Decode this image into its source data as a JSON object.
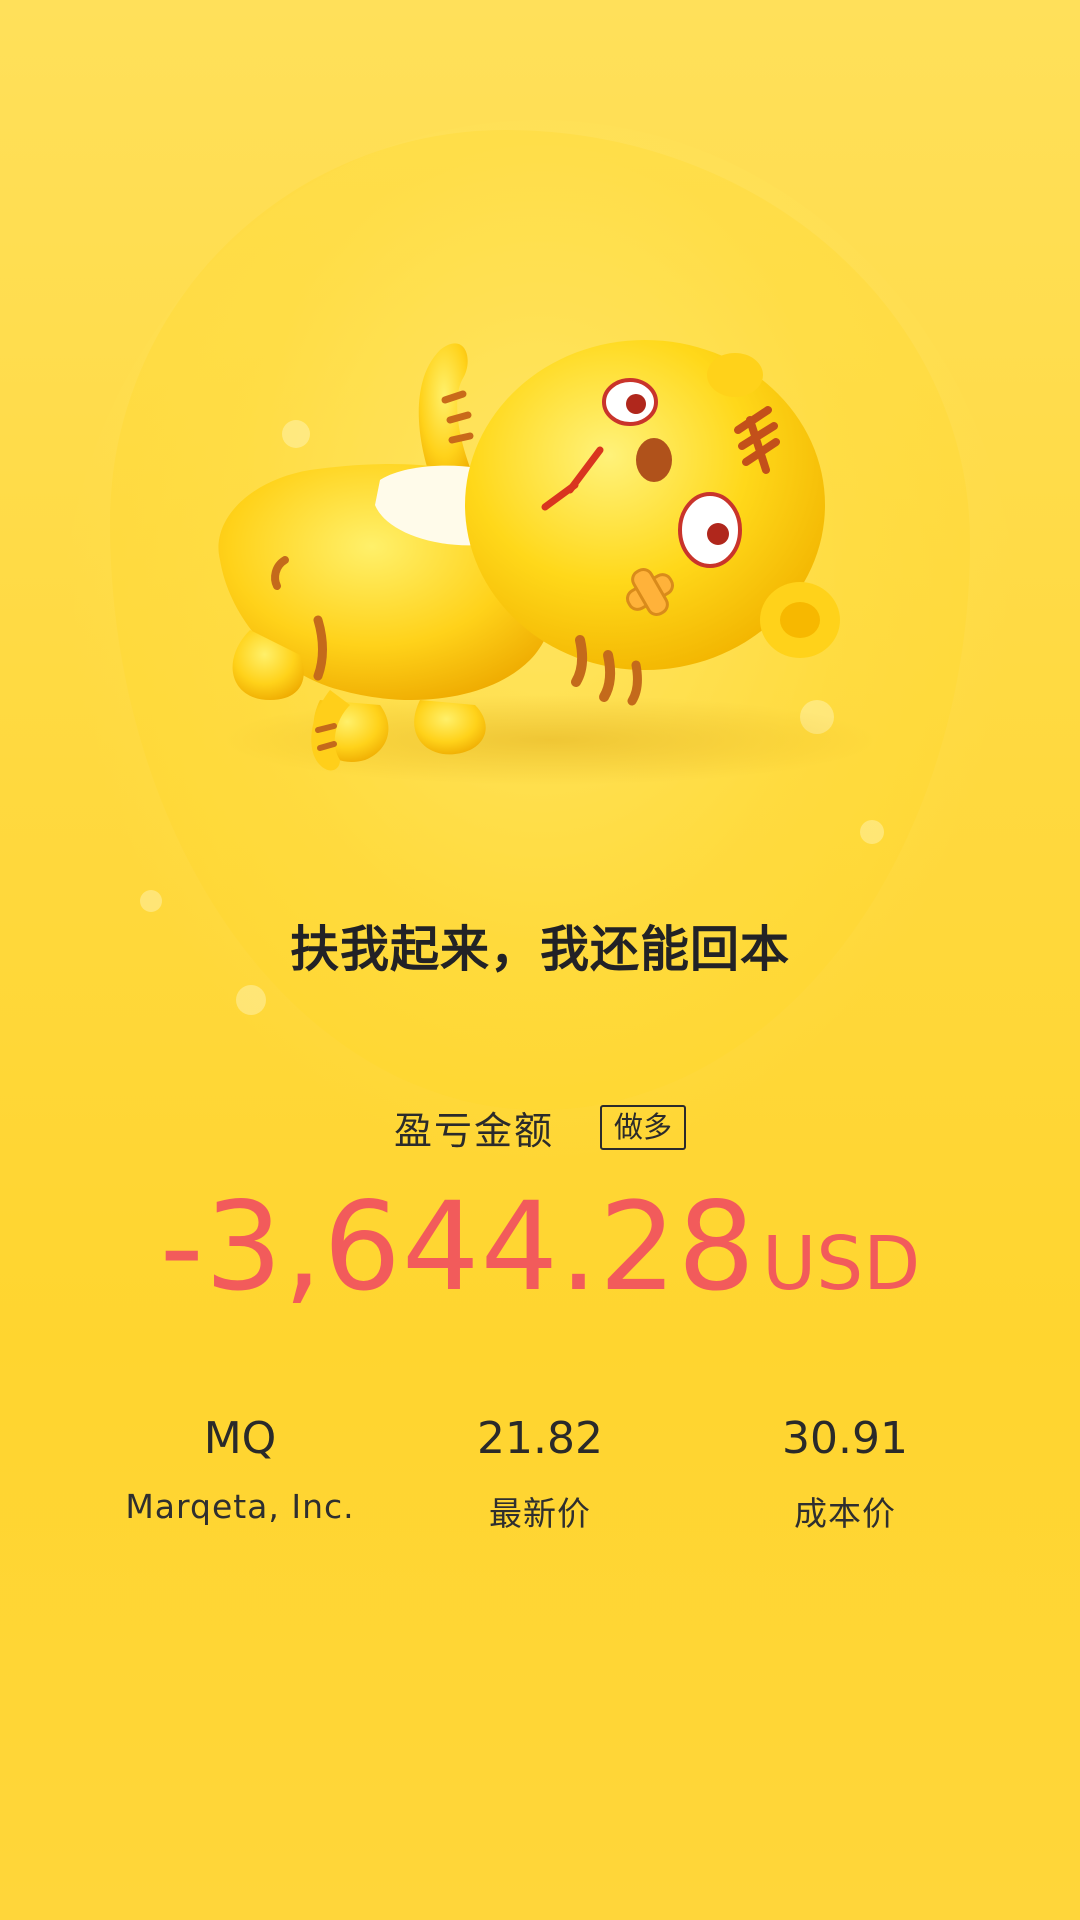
{
  "slogan": "扶我起来，我还能回本",
  "pnl": {
    "label": "盈亏金额",
    "direction_badge": "做多",
    "amount": "-3,644.28",
    "currency": "USD",
    "color": "#f25b5b"
  },
  "stats": {
    "symbol": {
      "value": "MQ",
      "label": "Marqeta, Inc."
    },
    "last_price": {
      "value": "21.82",
      "label": "最新价"
    },
    "cost_price": {
      "value": "30.91",
      "label": "成本价"
    }
  },
  "illustration": {
    "icon": "sad-tiger-mascot-icon"
  },
  "theme": {
    "background": "#ffd93f",
    "text": "#2a2a2a"
  }
}
